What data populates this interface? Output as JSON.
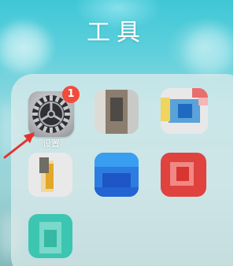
{
  "folder": {
    "title": "工具"
  },
  "apps": [
    {
      "name": "settings",
      "label": "设置",
      "badge": "1",
      "icon": "gear-icon"
    },
    {
      "name": "blurred-app-2",
      "icon": "blurred-app-icon"
    },
    {
      "name": "blurred-app-3",
      "icon": "blurred-app-icon"
    },
    {
      "name": "blurred-app-4",
      "icon": "blurred-app-icon"
    },
    {
      "name": "blurred-app-5",
      "icon": "blurred-app-icon"
    },
    {
      "name": "blurred-app-6",
      "icon": "blurred-app-icon"
    },
    {
      "name": "blurred-app-7",
      "icon": "blurred-app-icon"
    }
  ],
  "annotation": {
    "arrow_color": "#e5322d"
  },
  "colors": {
    "badge": "#f24b3b",
    "wallpaper": "#5fd0dc"
  }
}
